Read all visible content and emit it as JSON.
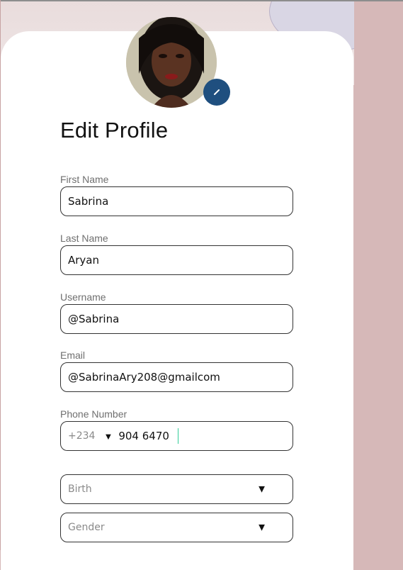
{
  "page": {
    "title": "Edit Profile"
  },
  "fields": {
    "first_name": {
      "label": "First Name",
      "value": "Sabrina"
    },
    "last_name": {
      "label": "Last Name",
      "value": "Aryan"
    },
    "username": {
      "label": "Username",
      "value": "@Sabrina"
    },
    "email": {
      "label": "Email",
      "value": "@SabrinaAry208@gmailcom"
    },
    "phone": {
      "label": "Phone Number",
      "country_code": "+234",
      "value": "904 6470"
    }
  },
  "selects": {
    "birth": {
      "placeholder": "Birth"
    },
    "gender": {
      "placeholder": "Gender"
    }
  },
  "icons": {
    "edit": "pencil-icon",
    "dropdown": "triangle-down-icon"
  },
  "colors": {
    "accent": "#1f4f7f",
    "background": "#d6b8b8",
    "cursor": "#33cc99"
  }
}
